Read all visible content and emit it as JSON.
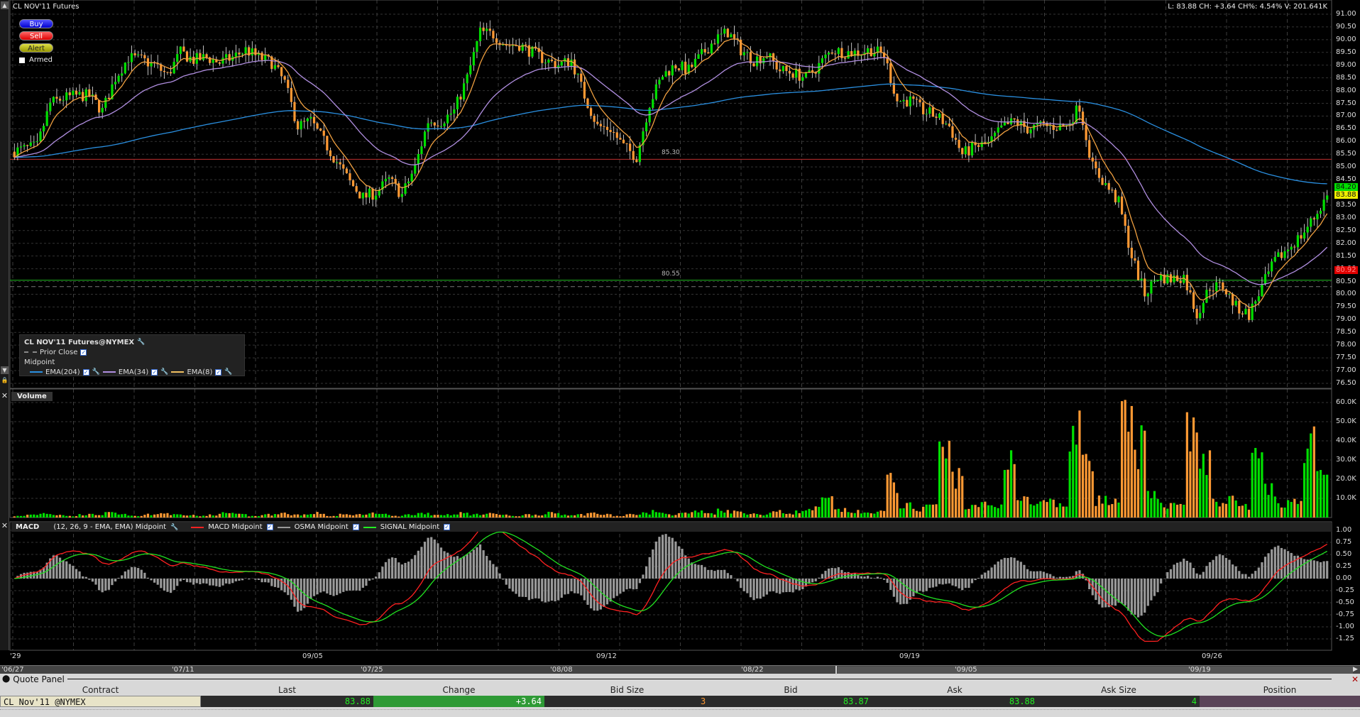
{
  "window": {
    "title": "CL NOV'11 Futures",
    "quote_line": "L: 83.88 CH: +3.64 CH%: 4.54% V: 201.641K"
  },
  "order_buttons": {
    "buy": "Buy",
    "sell": "Sell",
    "alert": "Alert",
    "armed": "Armed"
  },
  "legend": {
    "title": "CL NOV'11 Futures@NYMEX",
    "prior_close": "Prior Close",
    "midpoint": "Midpoint",
    "ema204": "EMA(204)",
    "ema34": "EMA(34)",
    "ema8": "EMA(8)"
  },
  "levels": [
    {
      "label": "85.30",
      "price": 85.3,
      "color": "#c03030"
    },
    {
      "label": "80.55",
      "price": 80.55,
      "color": "#20c020"
    }
  ],
  "price_axis": {
    "ticks": [
      "91.00",
      "90.50",
      "90.00",
      "89.50",
      "89.00",
      "88.50",
      "88.00",
      "87.50",
      "87.00",
      "86.50",
      "86.00",
      "85.50",
      "85.00",
      "84.50",
      "84.00",
      "83.50",
      "83.00",
      "82.50",
      "82.00",
      "81.50",
      "81.00",
      "80.50",
      "80.00",
      "79.50",
      "79.00",
      "78.50",
      "78.00",
      "77.50",
      "77.00",
      "76.50"
    ],
    "highlights": [
      {
        "label": "84.20",
        "price": 84.2,
        "color": "#00e000"
      },
      {
        "label": "83.88",
        "price": 83.88,
        "color": "#f0f000"
      },
      {
        "label": "80.92",
        "price": 80.92,
        "color": "#e00000"
      }
    ]
  },
  "volume_panel": {
    "title": "Volume",
    "ticks": [
      "60.0K",
      "50.0K",
      "40.0K",
      "30.0K",
      "20.0K",
      "10.0K"
    ]
  },
  "macd_panel": {
    "title": "MACD",
    "params": "(12, 26, 9 - EMA, EMA) Midpoint",
    "macd": "MACD Midpoint",
    "osma": "OSMA Midpoint",
    "signal": "SIGNAL Midpoint",
    "ticks": [
      "1.00",
      "0.75",
      "0.50",
      "0.25",
      "0.00",
      "-0.25",
      "-0.50",
      "-0.75",
      "-1.00",
      "-1.25"
    ]
  },
  "x_axis": {
    "labels": [
      "'29",
      "09/05",
      "09/12",
      "09/19",
      "09/26"
    ]
  },
  "navigator": {
    "labels": [
      "'06/27",
      "'07/11",
      "'07/25",
      "'08/08",
      "'08/22",
      "'09/05",
      "'09/19"
    ]
  },
  "quote_panel": {
    "title": "Quote Panel",
    "columns": [
      "Contract",
      "Last",
      "Change",
      "Bid Size",
      "Bid",
      "Ask",
      "Ask Size",
      "Position"
    ],
    "row": {
      "contract": "CL Nov'11 @NYMEX",
      "last": "83.88",
      "change": "+3.64",
      "bid_size": "3",
      "bid": "83.87",
      "ask": "83.88",
      "ask_size": "4",
      "position": ""
    }
  },
  "colors": {
    "up": "#00e000",
    "down": "#ff9933",
    "ema204": "#2a8fe0",
    "ema34": "#b08ee0",
    "ema8": "#f0a040",
    "macd": "#ff2020",
    "signal": "#20e020",
    "osma": "#999999"
  },
  "chart_data": {
    "type": "candlestick",
    "ylim": [
      76.5,
      91.5
    ],
    "closes": [
      85.6,
      85.7,
      85.8,
      87.5,
      87.7,
      87.8,
      87.8,
      87.2,
      88.5,
      89.3,
      89.2,
      89.0,
      88.6,
      89.5,
      89.2,
      89.3,
      89.1,
      89.3,
      89.6,
      89.3,
      89.1,
      88.3,
      86.6,
      86.8,
      86.0,
      85.2,
      84.4,
      83.8,
      84.0,
      84.5,
      83.9,
      85.0,
      86.8,
      86.8,
      87.2,
      88.5,
      90.3,
      90.2,
      89.8,
      89.8,
      89.5,
      89.2,
      89.0,
      89.2,
      87.8,
      86.6,
      86.5,
      85.8,
      85.4,
      87.5,
      88.6,
      89.0,
      88.8,
      89.4,
      90.0,
      90.3,
      89.6,
      89.2,
      89.4,
      88.8,
      88.7,
      88.5,
      89.0,
      89.6,
      89.5,
      89.5,
      89.6,
      89.4,
      87.6,
      87.6,
      87.2,
      87.0,
      86.6,
      85.5,
      85.8,
      85.9,
      86.5,
      86.8,
      86.5,
      86.6,
      86.6,
      86.6,
      87.4,
      85.0,
      84.3,
      83.6,
      81.5,
      80.0,
      80.7,
      80.6,
      80.7,
      79.2,
      80.3,
      80.3,
      79.5,
      79.2,
      80.3,
      81.3,
      81.8,
      82.3,
      83.0,
      83.88
    ],
    "volume_k": [
      2,
      1,
      2,
      3,
      2,
      1,
      2,
      2,
      3,
      2,
      1,
      2,
      3,
      2,
      2,
      1,
      2,
      3,
      2,
      1,
      2,
      3,
      2,
      2,
      3,
      1,
      2,
      2,
      3,
      2,
      1,
      2,
      3,
      2,
      2,
      3,
      2,
      3,
      2,
      1,
      2,
      2,
      3,
      2,
      2,
      3,
      2,
      1,
      2,
      3,
      4,
      2,
      3,
      4,
      3,
      5,
      4,
      3,
      2,
      4,
      3,
      4,
      6,
      12,
      5,
      4,
      3,
      4,
      24,
      8,
      6,
      9,
      44,
      30,
      7,
      9,
      8,
      44,
      12,
      9,
      10,
      8,
      56,
      47,
      12,
      10,
      63,
      50,
      14,
      9,
      12,
      57,
      40,
      10,
      12,
      8,
      40,
      18,
      10,
      12,
      48,
      27
    ]
  }
}
